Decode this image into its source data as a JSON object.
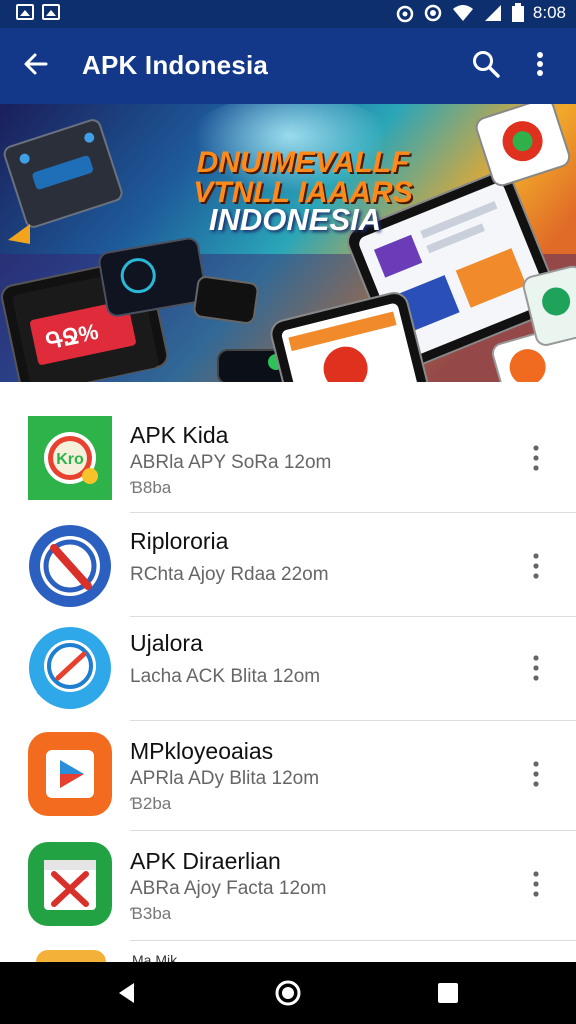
{
  "status_bar": {
    "time": "8:08",
    "icons": [
      "image-icon",
      "gallery-icon",
      "alarm-icon",
      "sync-icon",
      "wifi-icon",
      "signal-icon",
      "battery-icon"
    ]
  },
  "app_bar": {
    "title": "APK Indonesia",
    "icons": [
      "back-arrow-icon",
      "search-icon",
      "more-vert-icon"
    ]
  },
  "banner": {
    "heading_lines": [
      "DNUIMEVALLF",
      "VTNLL IAAARS"
    ],
    "subheading": "INDONESIA",
    "colors": {
      "bg_left": "#17275e",
      "bg_mid": "#1f7fa6",
      "bg_right": "#f1a82a"
    }
  },
  "apps": [
    {
      "name": "APK Kida",
      "subtitle": "ABRla APY SoRa 12om",
      "meta": "Ɓ8ba",
      "icon": "kro-app-icon",
      "color": "#2db34a"
    },
    {
      "name": "Riplororia",
      "subtitle": "RChta Ajoy Rdaa 22om",
      "meta": "",
      "icon": "no-sign-app-icon",
      "color": "#2b5fc0"
    },
    {
      "name": "Ujalora",
      "subtitle": "Lacha ACK Blita 12om",
      "meta": "",
      "icon": "compass-app-icon",
      "color": "#2ea8e8"
    },
    {
      "name": "MPkloyeoaias",
      "subtitle": "APRla ADy Blita 12om",
      "meta": "Ɓ2ba",
      "icon": "play-app-icon",
      "color": "#f36b1f"
    },
    {
      "name": "APK Diraerlian",
      "subtitle": "ABRa Ajoy Facta 12om",
      "meta": "Ɓ3ba",
      "icon": "cross-box-app-icon",
      "color": "#23a243"
    }
  ],
  "peek_item": {
    "name": "Ma Mik..."
  },
  "nav_bar": {
    "icons": [
      "back-nav-icon",
      "home-nav-icon",
      "recents-nav-icon"
    ]
  }
}
